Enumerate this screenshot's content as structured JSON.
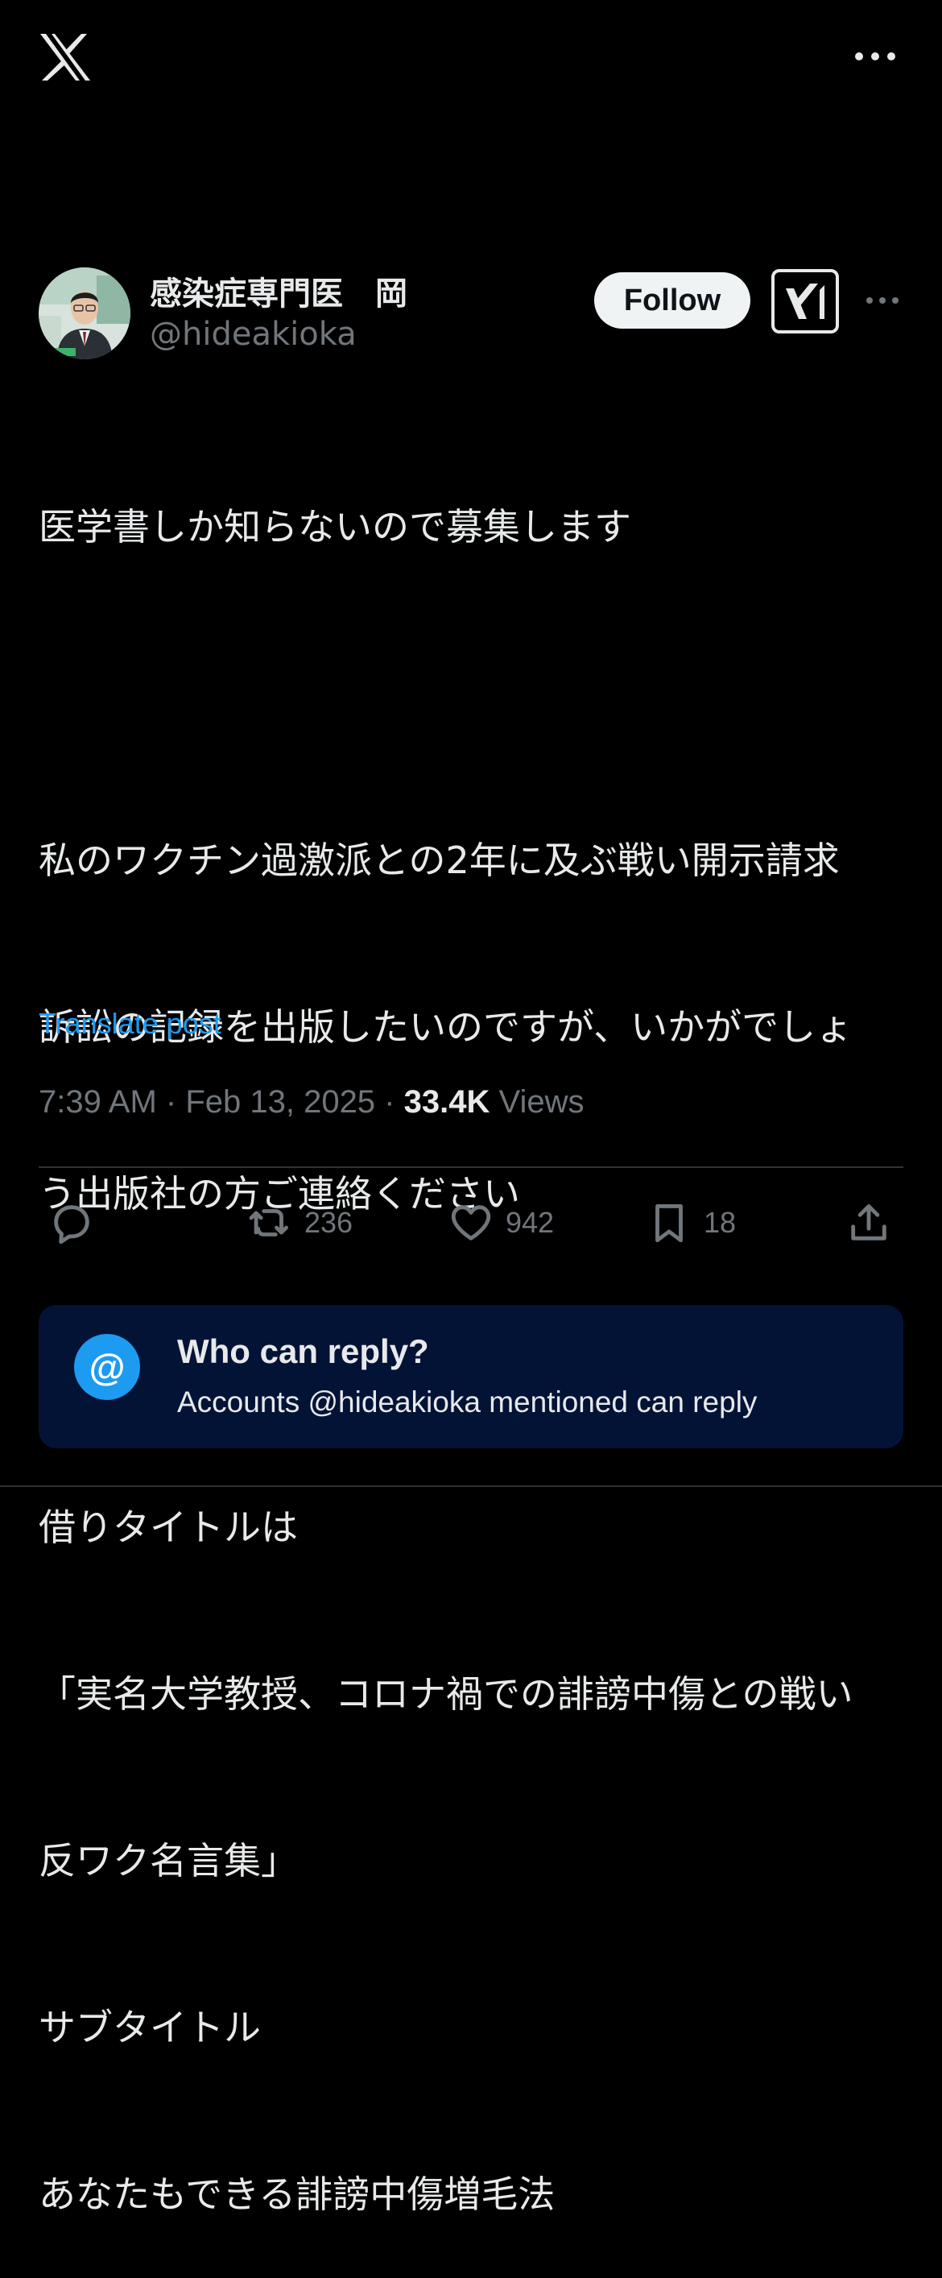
{
  "header": {
    "logo_icon": "x-logo-icon",
    "more_icon": "more-horizontal-icon"
  },
  "author": {
    "display_name": "感染症専門医　岡",
    "handle": "@hideakioka",
    "follow_label": "Follow",
    "grok_icon": "grok-icon",
    "more_icon": "more-horizontal-icon"
  },
  "tweet": {
    "lines": [
      "医学書しか知らないので募集します",
      "",
      "私のワクチン過激派との2年に及ぶ戦い開示請求",
      "訴訟の記録を出版したいのですが、いかがでしょ",
      "う出版社の方ご連絡ください",
      "",
      "借りタイトルは",
      "「実名大学教授、コロナ禍での誹謗中傷との戦い",
      "反ワク名言集」",
      "サブタイトル",
      "あなたもできる誹謗中傷増毛法"
    ],
    "translate_label": "Translate post",
    "time": "7:39 AM",
    "date": "Feb 13, 2025",
    "separator": " · ",
    "views_count": "33.4K",
    "views_label": "Views"
  },
  "actions": {
    "reply": {
      "icon": "reply-icon",
      "count": ""
    },
    "retweet": {
      "icon": "retweet-icon",
      "count": "236"
    },
    "like": {
      "icon": "heart-icon",
      "count": "942"
    },
    "bookmark": {
      "icon": "bookmark-icon",
      "count": "18"
    },
    "share": {
      "icon": "share-icon"
    }
  },
  "reply_settings": {
    "icon_text": "@",
    "title": "Who can reply?",
    "description": "Accounts @hideakioka mentioned can reply"
  },
  "colors": {
    "background": "#000000",
    "text": "#e7e9ea",
    "muted": "#71767b",
    "accent": "#1d9bf0",
    "reply_box": "#031336"
  }
}
